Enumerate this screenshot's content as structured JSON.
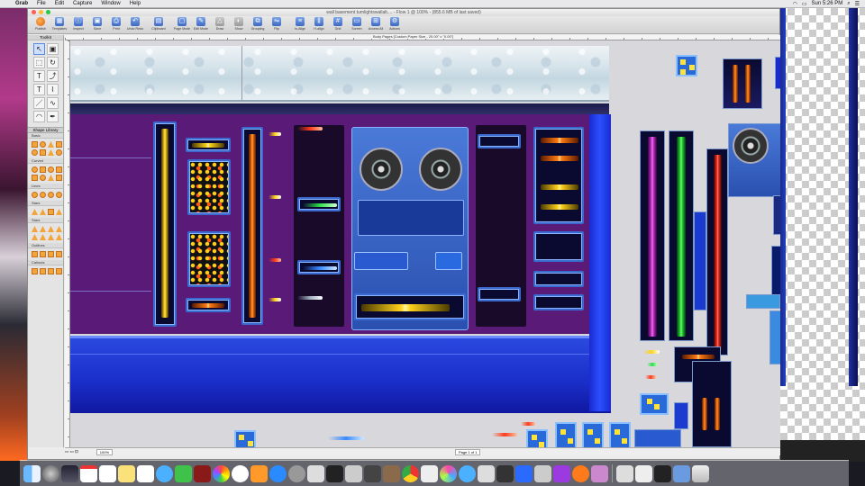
{
  "menubar": {
    "app_name": "Grab",
    "items": [
      "File",
      "Edit",
      "Capture",
      "Window",
      "Help"
    ],
    "clock": "Sun 5:26 PM"
  },
  "window": {
    "title": "wall basement turnlightswallalt.... - Flow 1 @ 100% - (855.6 MB of last saved)"
  },
  "toolbar": {
    "buttons": [
      "Publish",
      "Templates",
      "Inspect",
      "Save",
      "Print",
      "Undo Redo",
      "Clipboard",
      "Page Mode",
      "Edit Mode",
      "Draw",
      "Show",
      "Grouping",
      "Flip",
      "In-Align",
      "H-align",
      "Grid",
      "Screen",
      "Access All",
      "Actions"
    ]
  },
  "toolkit": {
    "title": "Toolkit",
    "library_title": "Shape Library",
    "categories": [
      "Basic",
      "Curved",
      "Lines",
      "Stars",
      "Stars",
      "Outlines",
      "Callouts"
    ]
  },
  "ruler": {
    "page_label": "Body Pages [Custom Paper Size - 20.00\" x \"0.00\"]"
  },
  "status": {
    "zoom": "100%",
    "page": "Page 1 of 1"
  },
  "colors": {
    "bay_purple": "#5a1a78",
    "floor_blue": "#1a2ec8",
    "ice_top": "#d5e3ea"
  },
  "dock_icons": [
    "finder-icon",
    "launchpad-icon",
    "mission-control-icon",
    "calendar-icon",
    "notes-icon",
    "reminders-icon",
    "stickies-icon",
    "messages-icon",
    "facetime-icon",
    "photo-booth-icon",
    "photos-icon",
    "itunes-icon",
    "ibooks-icon",
    "app-store-icon",
    "system-preferences-icon",
    "grab-icon",
    "preview-icon",
    "finalcut-icon",
    "imovie-icon",
    "chrome-icon",
    "flowchart-icon",
    "hue-icon",
    "safari-icon",
    "screenshot-icon",
    "camera-icon",
    "image-capture-icon",
    "mail-icon",
    "dictionary-icon",
    "affinity-icon",
    "blender-icon",
    "clapper-icon",
    "folder-icon",
    "preview2-icon",
    "terminal-icon",
    "downloads-icon",
    "trash-icon"
  ]
}
